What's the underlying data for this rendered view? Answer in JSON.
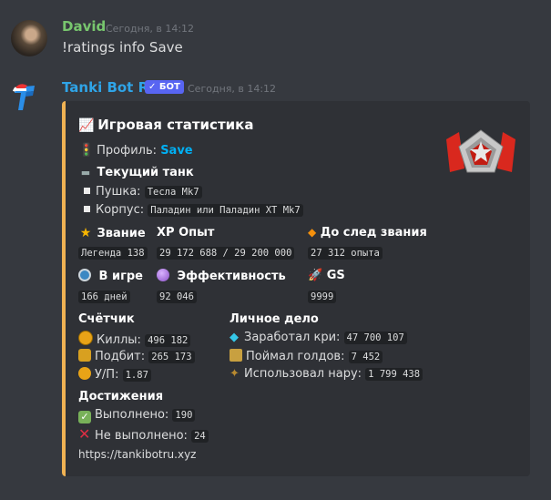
{
  "message1": {
    "author": "David",
    "author_color": "#78c66e",
    "timestamp": "Сегодня, в 14:12",
    "text": "!ratings info Save"
  },
  "message2": {
    "author": "Tanki Bot RU",
    "author_color": "#2fa4e7",
    "badge": "✓ БОТ",
    "timestamp": "Сегодня, в 14:12"
  },
  "embed": {
    "accent_color": "#f0b253",
    "title_icon": "chart-increasing-icon",
    "title": "Игровая статистика",
    "profile_label": "Профиль:",
    "profile_name": "Save",
    "tank_label": "Текущий танк",
    "gun_label": "Пушка:",
    "gun_value": "Тесла Mk7",
    "hull_label": "Корпус:",
    "hull_value": "Паладин или Паладин XT Mk7",
    "rank_label": "Звание",
    "rank_value": "Легенда 138",
    "xp_icon": "XP",
    "xp_label": "Опыт",
    "xp_value": "29 172 688 / 29 200 000",
    "next_label": "До след звания",
    "next_value": "27 312 опыта",
    "ingame_label": "В игре",
    "ingame_value": "166 дней",
    "eff_label": "Эффективность",
    "eff_value": "92 046",
    "gs_label": "GS",
    "gs_value": "9999",
    "counter_title": "Счётчик",
    "kills_label": "Киллы:",
    "kills_value": "496 182",
    "deaths_label": "Подбит:",
    "deaths_value": "265 173",
    "kd_label": "У/П:",
    "kd_value": "1.87",
    "personal_title": "Личное дело",
    "crystals_label": "Заработал кри:",
    "crystals_value": "47 700 107",
    "golds_label": "Поймал голдов:",
    "golds_value": "7 452",
    "supplies_label": "Использовал нару:",
    "supplies_value": "1 799 438",
    "achv_title": "Достижения",
    "done_label": "Выполнено:",
    "done_value": "190",
    "notdone_label": "Не выполнено:",
    "notdone_value": "24",
    "footer_link": "https://tankibotru.xyz"
  }
}
